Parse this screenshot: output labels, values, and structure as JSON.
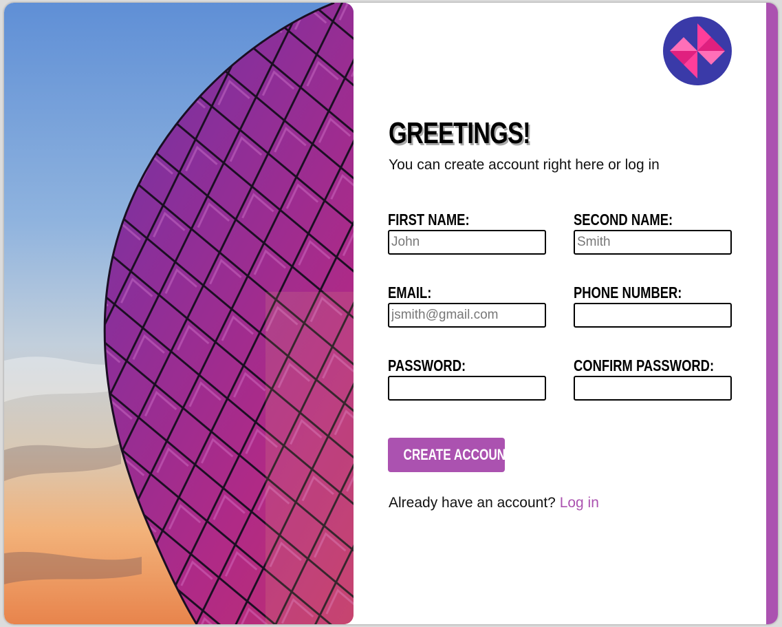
{
  "header": {
    "title": "GREETINGS!",
    "subtitle": "You can create account right here or log in"
  },
  "form": {
    "first_name": {
      "label": "FIRST NAME:",
      "placeholder": "John"
    },
    "second_name": {
      "label": "SECOND NAME:",
      "placeholder": "Smith"
    },
    "email": {
      "label": "EMAIL:",
      "placeholder": "jsmith@gmail.com"
    },
    "phone": {
      "label": "PHONE NUMBER:",
      "placeholder": ""
    },
    "password": {
      "label": "PASSWORD:",
      "placeholder": ""
    },
    "confirm_password": {
      "label": "CONFIRM PASSWORD:",
      "placeholder": ""
    },
    "submit_label": "CREATE ACCOUNT"
  },
  "footer": {
    "prompt": "Already have an account?",
    "login_link": "Log in"
  },
  "hero_image": {
    "subject": "stadium-facade-photo"
  },
  "logo": {
    "icon": "pinwheel-logo-icon"
  },
  "colors": {
    "accent": "#ab52b0",
    "logo_bg": "#3a3aa8",
    "logo_fg": "#ff3e9a"
  }
}
